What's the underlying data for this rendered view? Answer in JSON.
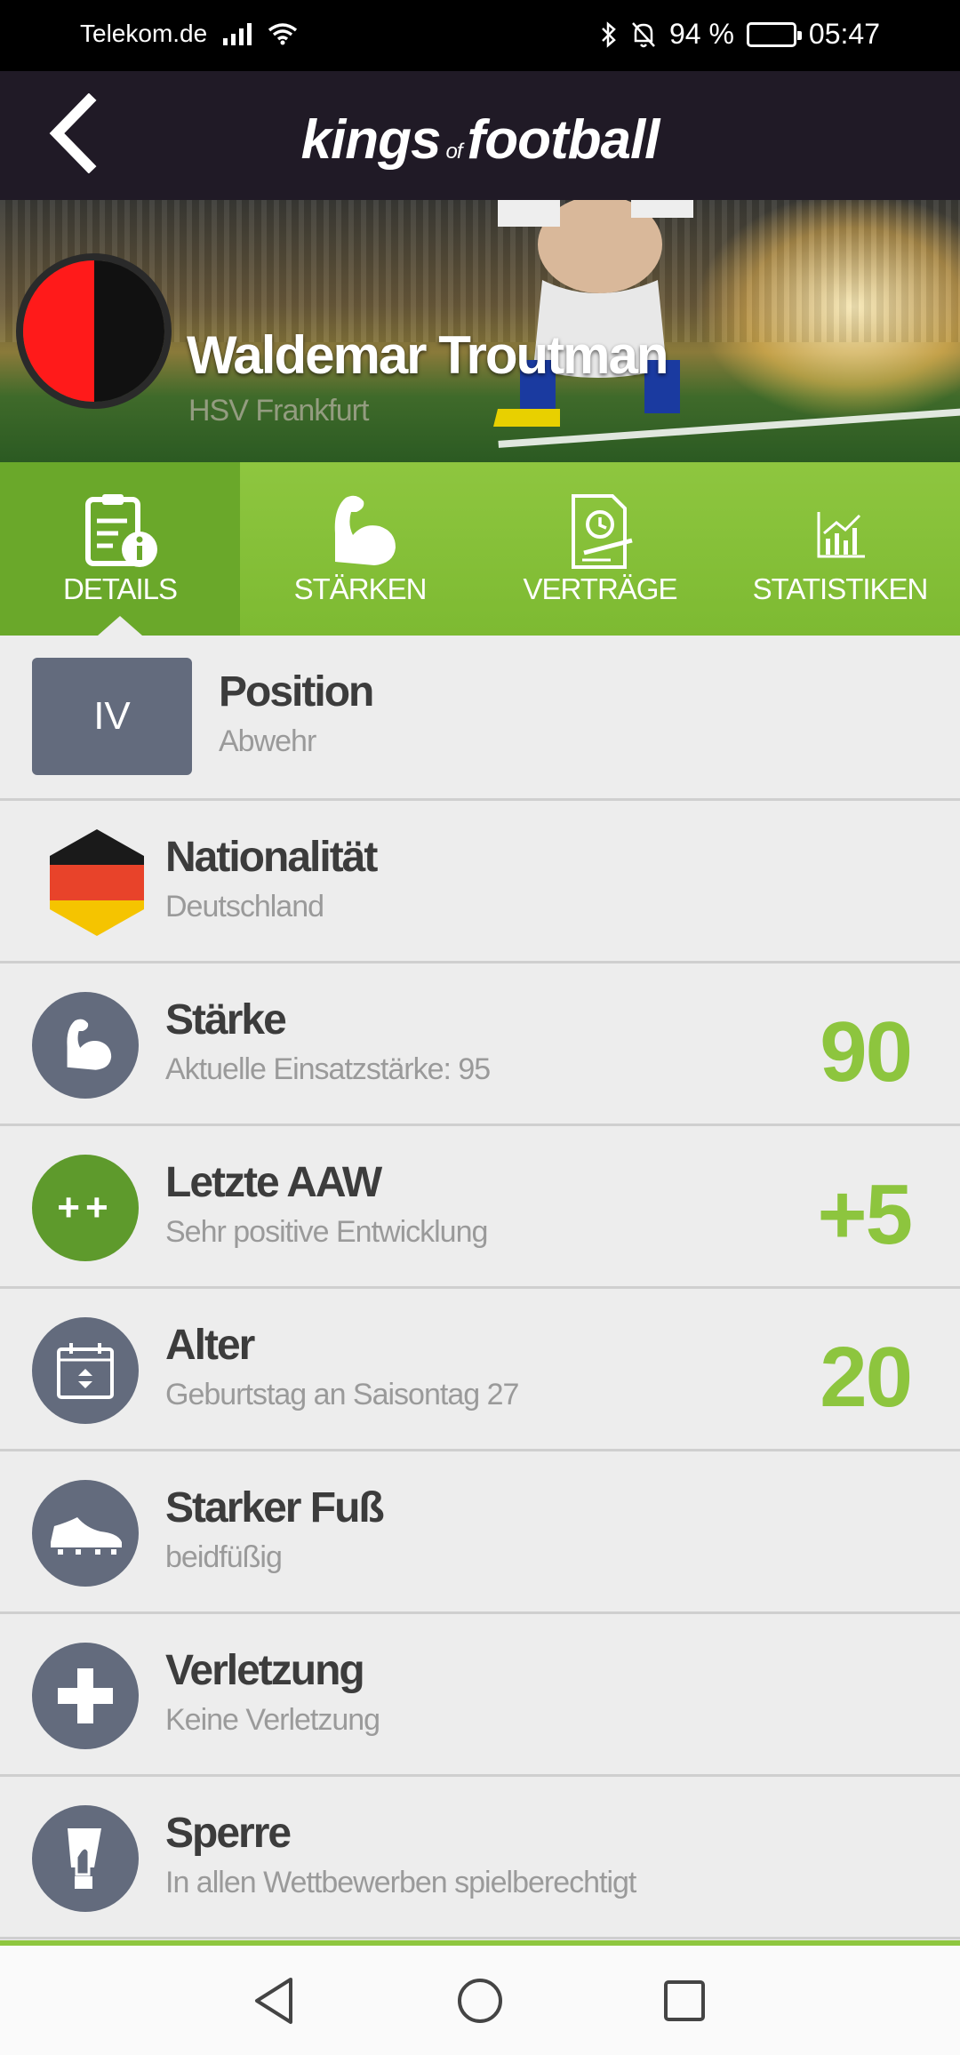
{
  "status_bar": {
    "carrier": "Telekom.de",
    "battery_percent_text": "94 %",
    "battery_level": 0.94,
    "time": "05:47"
  },
  "header": {
    "logo_kings": "kings",
    "logo_of": "of",
    "logo_football": "football"
  },
  "player": {
    "name": "Waldemar Troutman",
    "club": "HSV Frankfurt",
    "club_colors": [
      "#ff1a1a",
      "#111111"
    ]
  },
  "tabs": [
    {
      "label": "DETAILS",
      "icon": "clipboard-info-icon",
      "active": true
    },
    {
      "label": "STÄRKEN",
      "icon": "flexed-biceps-icon",
      "active": false
    },
    {
      "label": "VERTRÄGE",
      "icon": "contract-icon",
      "active": false
    },
    {
      "label": "STATISTIKEN",
      "icon": "bar-chart-icon",
      "active": false
    }
  ],
  "details": {
    "position": {
      "badge": "IV",
      "title": "Position",
      "subtitle": "Abwehr"
    },
    "nationality": {
      "title": "Nationalität",
      "subtitle": "Deutschland",
      "icon": "germany-flag-icon"
    },
    "strength": {
      "title": "Stärke",
      "subtitle": "Aktuelle Einsatzstärke: 95",
      "value": "90",
      "icon": "flexed-biceps-icon"
    },
    "last_aaw": {
      "title": "Letzte AAW",
      "subtitle": "Sehr positive Entwicklung",
      "value": "+5",
      "icon_text": "++"
    },
    "age": {
      "title": "Alter",
      "subtitle": "Geburtstag an Saisontag 27",
      "value": "20",
      "icon": "calendar-icon"
    },
    "strong_foot": {
      "title": "Starker Fuß",
      "subtitle": "beidfüßig",
      "icon": "football-boot-icon"
    },
    "injury": {
      "title": "Verletzung",
      "subtitle": "Keine Verletzung",
      "icon": "medical-cross-icon"
    },
    "suspension": {
      "title": "Sperre",
      "subtitle": "In allen Wettbewerben spielberechtigt",
      "icon": "card-hand-icon"
    }
  },
  "colors": {
    "accent_green": "#8dc53e",
    "header_dark": "#201a26",
    "icon_slate": "#636b7d"
  }
}
